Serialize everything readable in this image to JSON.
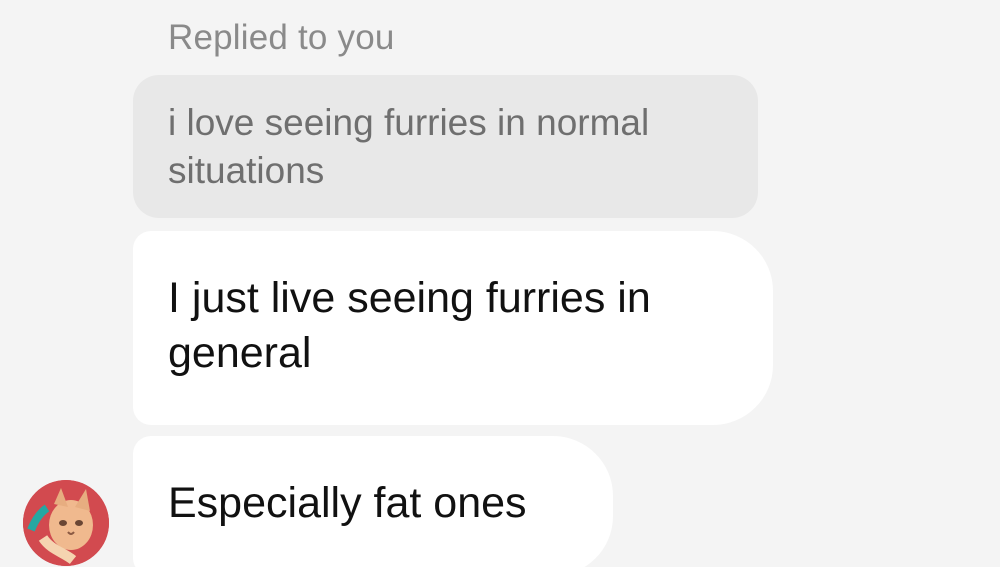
{
  "chat": {
    "reply_label": "Replied to you",
    "quoted_message": "i love seeing furries in normal situations",
    "messages": [
      {
        "text": "I just live seeing furries in general"
      },
      {
        "text": "Especially fat ones"
      }
    ],
    "avatar_icon": "cat-avatar-icon"
  },
  "colors": {
    "background": "#f4f4f4",
    "quoted_bubble": "#e8e8e8",
    "message_bubble": "#ffffff",
    "reply_label": "#8a8a8a",
    "quoted_text": "#6f6f6f",
    "message_text": "#111111"
  }
}
